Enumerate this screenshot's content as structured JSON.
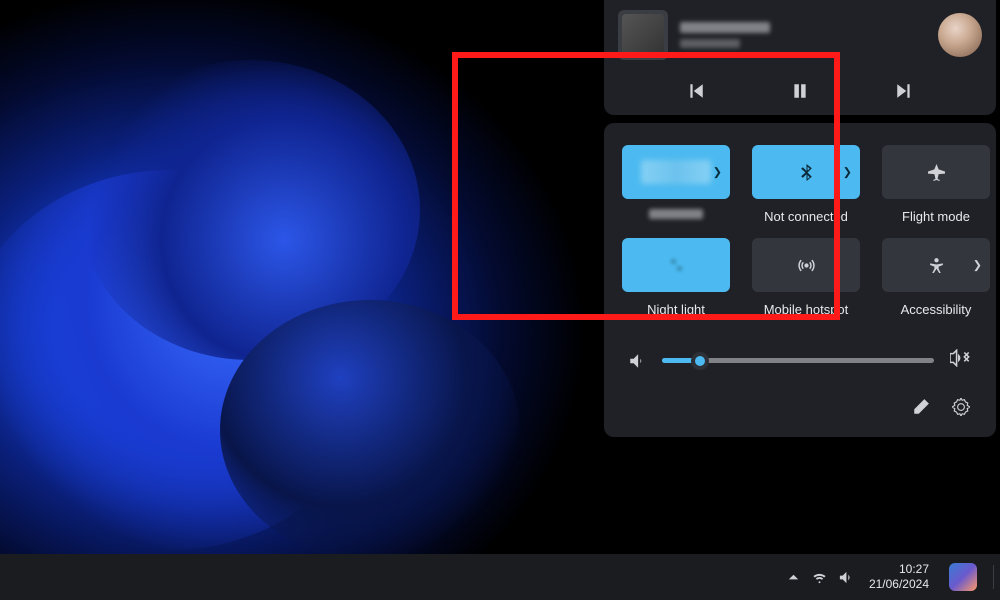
{
  "colors": {
    "accent": "#4cbaf0",
    "panel": "#1f2126",
    "tile_off": "#33363c"
  },
  "media": {
    "prev_icon": "prev",
    "pause_icon": "pause",
    "next_icon": "next"
  },
  "qa": {
    "wifi": {
      "label": "",
      "state": "on"
    },
    "bluetooth": {
      "label": "Not connected",
      "state": "on"
    },
    "flight": {
      "label": "Flight mode",
      "state": "off"
    },
    "night": {
      "label": "Night light",
      "state": "on"
    },
    "hotspot": {
      "label": "Mobile hotspot",
      "state": "off"
    },
    "accessibility": {
      "label": "Accessibility",
      "state": "off"
    }
  },
  "volume": {
    "value": 14
  },
  "footer": {
    "edit": "edit",
    "settings": "settings"
  },
  "tray": {
    "chevron": "chevron-up",
    "wifi": "wifi",
    "speaker": "speaker"
  },
  "clock": {
    "time": "10:27",
    "date": "21/06/2024"
  }
}
